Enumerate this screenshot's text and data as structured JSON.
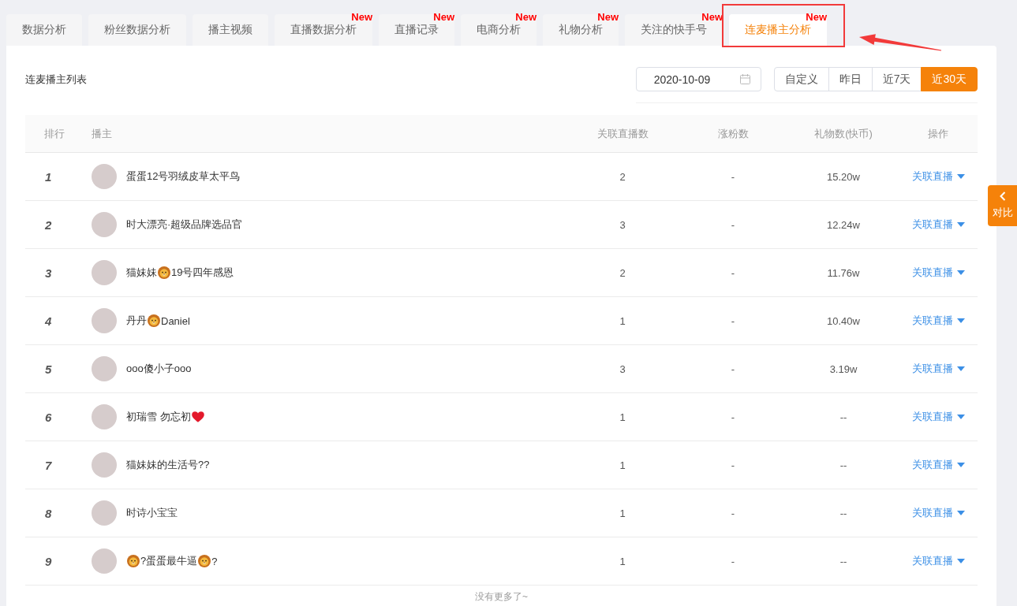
{
  "tabs": [
    {
      "label": "数据分析",
      "selected": false
    },
    {
      "label": "粉丝数据分析",
      "selected": false
    },
    {
      "label": "播主视频",
      "selected": false
    },
    {
      "label": "直播数据分析",
      "selected": false,
      "badge": "New"
    },
    {
      "label": "直播记录",
      "selected": false,
      "badge": "New"
    },
    {
      "label": "电商分析",
      "selected": false,
      "badge": "New"
    },
    {
      "label": "礼物分析",
      "selected": false,
      "badge": "New"
    },
    {
      "label": "关注的快手号",
      "selected": false,
      "badge": "New"
    },
    {
      "label": "连麦播主分析",
      "selected": true,
      "badge": "New"
    }
  ],
  "list_title": "连麦播主列表",
  "date_picker": {
    "value": "2020-10-09"
  },
  "range_buttons": [
    {
      "label": "自定义",
      "selected": false
    },
    {
      "label": "昨日",
      "selected": false
    },
    {
      "label": "近7天",
      "selected": false
    },
    {
      "label": "近30天",
      "selected": true
    }
  ],
  "table": {
    "columns": [
      "排行",
      "播主",
      "关联直播数",
      "涨粉数",
      "礼物数(快币)",
      "操作"
    ],
    "rows": [
      {
        "rank": "1",
        "name_parts": [
          {
            "kind": "text",
            "text": "蛋蛋12号羽绒皮草太平鸟"
          }
        ],
        "live_count": "2",
        "fans_gain": "-",
        "gifts": "15.20w",
        "action": "关联直播"
      },
      {
        "rank": "2",
        "name_parts": [
          {
            "kind": "text",
            "text": "时大漂亮·超级品牌选品官"
          }
        ],
        "live_count": "3",
        "fans_gain": "-",
        "gifts": "12.24w",
        "action": "关联直播"
      },
      {
        "rank": "3",
        "name_parts": [
          {
            "kind": "text",
            "text": "猫妹妹"
          },
          {
            "kind": "lion"
          },
          {
            "kind": "text",
            "text": "19号四年感恩"
          }
        ],
        "live_count": "2",
        "fans_gain": "-",
        "gifts": "11.76w",
        "action": "关联直播"
      },
      {
        "rank": "4",
        "name_parts": [
          {
            "kind": "text",
            "text": "丹丹"
          },
          {
            "kind": "lion"
          },
          {
            "kind": "text",
            "text": "Daniel"
          }
        ],
        "live_count": "1",
        "fans_gain": "-",
        "gifts": "10.40w",
        "action": "关联直播"
      },
      {
        "rank": "5",
        "name_parts": [
          {
            "kind": "text",
            "text": "ooo傻小子ooo"
          }
        ],
        "live_count": "3",
        "fans_gain": "-",
        "gifts": "3.19w",
        "action": "关联直播"
      },
      {
        "rank": "6",
        "name_parts": [
          {
            "kind": "text",
            "text": "初瑞雪 勿忘初"
          },
          {
            "kind": "heart"
          }
        ],
        "live_count": "1",
        "fans_gain": "-",
        "gifts": "--",
        "action": "关联直播"
      },
      {
        "rank": "7",
        "name_parts": [
          {
            "kind": "text",
            "text": "猫妹妹的生活号??"
          }
        ],
        "live_count": "1",
        "fans_gain": "-",
        "gifts": "--",
        "action": "关联直播"
      },
      {
        "rank": "8",
        "name_parts": [
          {
            "kind": "text",
            "text": "时诗小宝宝"
          }
        ],
        "live_count": "1",
        "fans_gain": "-",
        "gifts": "--",
        "action": "关联直播"
      },
      {
        "rank": "9",
        "name_parts": [
          {
            "kind": "lion"
          },
          {
            "kind": "text",
            "text": "?蛋蛋最牛逼"
          },
          {
            "kind": "lion"
          },
          {
            "kind": "text",
            "text": "?"
          }
        ],
        "live_count": "1",
        "fans_gain": "-",
        "gifts": "--",
        "action": "关联直播"
      }
    ]
  },
  "footer_note": "没有更多了~",
  "side_tab": {
    "label": "对比"
  }
}
